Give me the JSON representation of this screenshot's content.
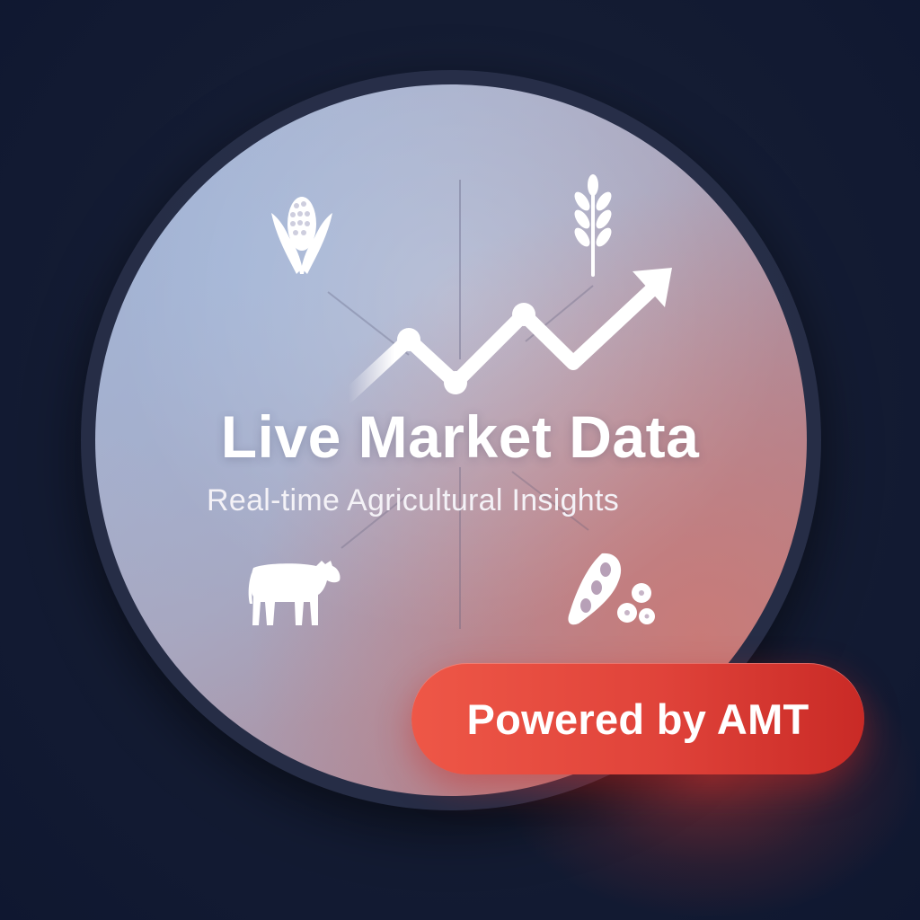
{
  "hero": {
    "title": "Live Market Data",
    "subtitle": "Real-time Agricultural Insights"
  },
  "badge": {
    "label": "Powered by AMT"
  },
  "icons": [
    "corn-icon",
    "wheat-icon",
    "cattle-icon",
    "soybean-icon",
    "trend-up-icon"
  ],
  "colors": {
    "background": "#141c33",
    "badge": "#e0433a",
    "text": "#ffffff"
  }
}
